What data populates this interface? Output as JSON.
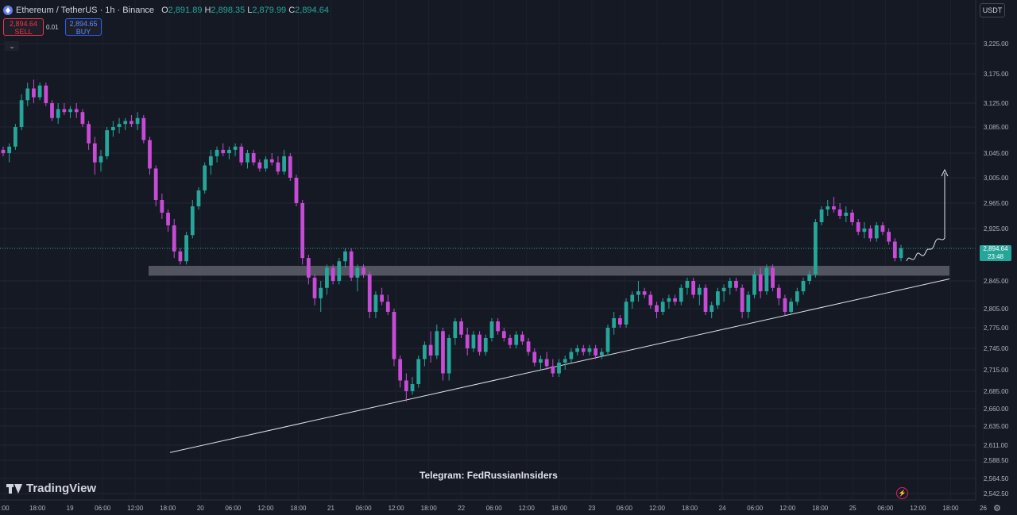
{
  "header": {
    "symbol": "Ethereum / TetherUS · 1h · Binance",
    "open_label": "O",
    "open": "2,891.89",
    "high_label": "H",
    "high": "2,898.35",
    "low_label": "L",
    "low": "2,879.99",
    "close_label": "C",
    "close": "2,894.64"
  },
  "trade": {
    "sell_price": "2,894.64",
    "sell_label": "SELL",
    "spread": "0.01",
    "buy_price": "2,894.65",
    "buy_label": "BUY"
  },
  "currency": "USDT",
  "price_tag": {
    "price": "2,894.64",
    "countdown": "23:48"
  },
  "brand": "TradingView",
  "watermark": "Telegram: FedRussianInsiders",
  "icons": {
    "collapse": "chevron-down-icon",
    "symbol_logo": "ethereum-icon",
    "bolt": "lightning-icon",
    "settings": "gear-icon"
  },
  "colors": {
    "bull": "#26a69a",
    "bear": "#c74bd6",
    "background": "#151924"
  },
  "chart_data": {
    "type": "candlestick",
    "price_axis": {
      "min": 2542.5,
      "max": 3250,
      "ticks": [
        "3,225.00",
        "3,175.00",
        "3,125.00",
        "3,085.00",
        "3,045.00",
        "3,005.00",
        "2,965.00",
        "2,925.00",
        "2,845.00",
        "2,805.00",
        "2,775.00",
        "2,745.00",
        "2,715.00",
        "2,685.00",
        "2,660.00",
        "2,635.00",
        "2,611.00",
        "2,588.50",
        "2,564.50",
        "2,542.50"
      ]
    },
    "time_axis": {
      "ticks": [
        ":00",
        "18:00",
        "19",
        "06:00",
        "12:00",
        "18:00",
        "20",
        "06:00",
        "12:00",
        "18:00",
        "21",
        "06:00",
        "12:00",
        "18:00",
        "22",
        "06:00",
        "12:00",
        "18:00",
        "23",
        "06:00",
        "12:00",
        "18:00",
        "24",
        "06:00",
        "12:00",
        "18:00",
        "25",
        "06:00",
        "12:00",
        "18:00",
        "26"
      ]
    },
    "last_price": 2894.64,
    "candles": [
      [
        3050,
        3055,
        3040,
        3045
      ],
      [
        3045,
        3060,
        3030,
        3055
      ],
      [
        3055,
        3090,
        3050,
        3085
      ],
      [
        3085,
        3140,
        3080,
        3130
      ],
      [
        3130,
        3160,
        3120,
        3150
      ],
      [
        3150,
        3165,
        3125,
        3135
      ],
      [
        3135,
        3160,
        3130,
        3155
      ],
      [
        3155,
        3160,
        3120,
        3125
      ],
      [
        3125,
        3130,
        3095,
        3100
      ],
      [
        3100,
        3125,
        3090,
        3115
      ],
      [
        3115,
        3125,
        3105,
        3110
      ],
      [
        3110,
        3120,
        3100,
        3115
      ],
      [
        3115,
        3125,
        3100,
        3110
      ],
      [
        3110,
        3115,
        3085,
        3090
      ],
      [
        3090,
        3095,
        3050,
        3060
      ],
      [
        3060,
        3070,
        3010,
        3030
      ],
      [
        3030,
        3050,
        3015,
        3040
      ],
      [
        3040,
        3085,
        3035,
        3080
      ],
      [
        3080,
        3095,
        3070,
        3085
      ],
      [
        3085,
        3100,
        3075,
        3090
      ],
      [
        3090,
        3100,
        3080,
        3095
      ],
      [
        3095,
        3105,
        3085,
        3090
      ],
      [
        3090,
        3110,
        3080,
        3100
      ],
      [
        3100,
        3105,
        3060,
        3065
      ],
      [
        3065,
        3070,
        3010,
        3020
      ],
      [
        3020,
        3025,
        2960,
        2970
      ],
      [
        2970,
        2980,
        2940,
        2950
      ],
      [
        2950,
        2955,
        2920,
        2930
      ],
      [
        2930,
        2940,
        2880,
        2890
      ],
      [
        2890,
        2895,
        2870,
        2875
      ],
      [
        2875,
        2920,
        2870,
        2915
      ],
      [
        2915,
        2970,
        2910,
        2960
      ],
      [
        2960,
        2990,
        2955,
        2985
      ],
      [
        2985,
        3030,
        2980,
        3025
      ],
      [
        3025,
        3050,
        3010,
        3040
      ],
      [
        3040,
        3055,
        3030,
        3050
      ],
      [
        3050,
        3060,
        3040,
        3045
      ],
      [
        3045,
        3055,
        3035,
        3050
      ],
      [
        3050,
        3060,
        3040,
        3055
      ],
      [
        3055,
        3060,
        3025,
        3030
      ],
      [
        3030,
        3050,
        3020,
        3045
      ],
      [
        3045,
        3050,
        3025,
        3030
      ],
      [
        3030,
        3035,
        3015,
        3020
      ],
      [
        3020,
        3040,
        3015,
        3035
      ],
      [
        3035,
        3045,
        3025,
        3030
      ],
      [
        3030,
        3040,
        3010,
        3015
      ],
      [
        3015,
        3050,
        3010,
        3040
      ],
      [
        3040,
        3045,
        3000,
        3005
      ],
      [
        3005,
        3010,
        2960,
        2965
      ],
      [
        2965,
        2970,
        2870,
        2880
      ],
      [
        2880,
        2885,
        2840,
        2850
      ],
      [
        2850,
        2855,
        2810,
        2820
      ],
      [
        2820,
        2845,
        2800,
        2835
      ],
      [
        2835,
        2870,
        2825,
        2865
      ],
      [
        2865,
        2870,
        2840,
        2845
      ],
      [
        2845,
        2880,
        2840,
        2875
      ],
      [
        2875,
        2895,
        2865,
        2890
      ],
      [
        2890,
        2895,
        2845,
        2850
      ],
      [
        2850,
        2870,
        2830,
        2865
      ],
      [
        2865,
        2870,
        2850,
        2855
      ],
      [
        2855,
        2860,
        2790,
        2800
      ],
      [
        2800,
        2830,
        2790,
        2825
      ],
      [
        2825,
        2835,
        2810,
        2815
      ],
      [
        2815,
        2825,
        2795,
        2800
      ],
      [
        2800,
        2805,
        2720,
        2730
      ],
      [
        2730,
        2735,
        2690,
        2700
      ],
      [
        2700,
        2710,
        2670,
        2685
      ],
      [
        2685,
        2705,
        2680,
        2695
      ],
      [
        2695,
        2735,
        2690,
        2730
      ],
      [
        2730,
        2755,
        2720,
        2750
      ],
      [
        2750,
        2770,
        2725,
        2735
      ],
      [
        2735,
        2780,
        2730,
        2770
      ],
      [
        2770,
        2775,
        2700,
        2710
      ],
      [
        2710,
        2765,
        2700,
        2760
      ],
      [
        2760,
        2790,
        2750,
        2785
      ],
      [
        2785,
        2790,
        2760,
        2765
      ],
      [
        2765,
        2775,
        2735,
        2745
      ],
      [
        2745,
        2770,
        2740,
        2765
      ],
      [
        2765,
        2770,
        2735,
        2740
      ],
      [
        2740,
        2765,
        2735,
        2760
      ],
      [
        2760,
        2790,
        2755,
        2785
      ],
      [
        2785,
        2790,
        2765,
        2770
      ],
      [
        2770,
        2775,
        2755,
        2760
      ],
      [
        2760,
        2765,
        2745,
        2750
      ],
      [
        2750,
        2770,
        2745,
        2765
      ],
      [
        2765,
        2770,
        2750,
        2755
      ],
      [
        2755,
        2760,
        2735,
        2740
      ],
      [
        2740,
        2745,
        2720,
        2725
      ],
      [
        2725,
        2735,
        2715,
        2730
      ],
      [
        2730,
        2740,
        2715,
        2720
      ],
      [
        2720,
        2730,
        2705,
        2710
      ],
      [
        2710,
        2730,
        2705,
        2725
      ],
      [
        2725,
        2735,
        2715,
        2730
      ],
      [
        2730,
        2745,
        2725,
        2740
      ],
      [
        2740,
        2750,
        2735,
        2745
      ],
      [
        2745,
        2750,
        2735,
        2740
      ],
      [
        2740,
        2750,
        2735,
        2745
      ],
      [
        2745,
        2750,
        2730,
        2735
      ],
      [
        2735,
        2745,
        2730,
        2740
      ],
      [
        2740,
        2780,
        2735,
        2775
      ],
      [
        2775,
        2800,
        2765,
        2790
      ],
      [
        2790,
        2795,
        2775,
        2780
      ],
      [
        2780,
        2820,
        2775,
        2815
      ],
      [
        2815,
        2830,
        2805,
        2825
      ],
      [
        2825,
        2845,
        2815,
        2830
      ],
      [
        2830,
        2835,
        2820,
        2825
      ],
      [
        2825,
        2830,
        2805,
        2810
      ],
      [
        2810,
        2815,
        2790,
        2800
      ],
      [
        2800,
        2820,
        2795,
        2815
      ],
      [
        2815,
        2825,
        2805,
        2820
      ],
      [
        2820,
        2825,
        2810,
        2815
      ],
      [
        2815,
        2840,
        2810,
        2835
      ],
      [
        2835,
        2850,
        2825,
        2845
      ],
      [
        2845,
        2850,
        2820,
        2825
      ],
      [
        2825,
        2840,
        2810,
        2835
      ],
      [
        2835,
        2840,
        2795,
        2800
      ],
      [
        2800,
        2815,
        2790,
        2810
      ],
      [
        2810,
        2835,
        2805,
        2830
      ],
      [
        2830,
        2840,
        2815,
        2835
      ],
      [
        2835,
        2850,
        2825,
        2845
      ],
      [
        2845,
        2850,
        2830,
        2835
      ],
      [
        2835,
        2840,
        2790,
        2800
      ],
      [
        2800,
        2830,
        2790,
        2825
      ],
      [
        2825,
        2860,
        2820,
        2855
      ],
      [
        2855,
        2865,
        2820,
        2830
      ],
      [
        2830,
        2870,
        2825,
        2865
      ],
      [
        2865,
        2870,
        2830,
        2835
      ],
      [
        2835,
        2840,
        2810,
        2820
      ],
      [
        2820,
        2825,
        2795,
        2800
      ],
      [
        2800,
        2820,
        2795,
        2815
      ],
      [
        2815,
        2835,
        2810,
        2830
      ],
      [
        2830,
        2850,
        2825,
        2845
      ],
      [
        2845,
        2860,
        2840,
        2855
      ],
      [
        2855,
        2940,
        2850,
        2935
      ],
      [
        2935,
        2960,
        2930,
        2955
      ],
      [
        2955,
        2970,
        2945,
        2960
      ],
      [
        2960,
        2975,
        2950,
        2955
      ],
      [
        2955,
        2965,
        2940,
        2945
      ],
      [
        2945,
        2960,
        2935,
        2950
      ],
      [
        2950,
        2955,
        2930,
        2935
      ],
      [
        2935,
        2940,
        2915,
        2920
      ],
      [
        2920,
        2935,
        2910,
        2925
      ],
      [
        2925,
        2930,
        2905,
        2910
      ],
      [
        2910,
        2935,
        2905,
        2930
      ],
      [
        2930,
        2935,
        2915,
        2920
      ],
      [
        2920,
        2925,
        2900,
        2905
      ],
      [
        2905,
        2910,
        2875,
        2880
      ],
      [
        2880,
        2900,
        2875,
        2895
      ]
    ],
    "support_zone": {
      "low": 2853,
      "high": 2868
    },
    "trendline": {
      "start_price": 2600,
      "end_price": 2848
    }
  }
}
